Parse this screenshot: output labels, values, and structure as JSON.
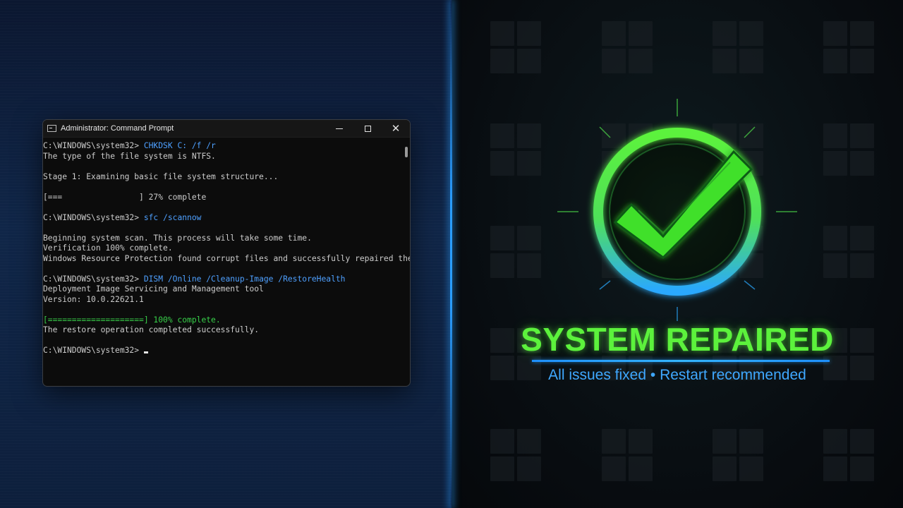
{
  "window": {
    "title": "Administrator: Command Prompt",
    "controls": {
      "minimize_icon": "minimize-icon",
      "maximize_icon": "maximize-icon",
      "close_icon": "close-icon"
    }
  },
  "terminal": {
    "lines": [
      {
        "prompt": "C:\\WINDOWS\\system32>",
        "command": " CHKDSK C: /f /r",
        "text": "",
        "style": "cmd"
      },
      {
        "prompt": "",
        "command": "",
        "text": "The type of the file system is NTFS.",
        "style": "normal"
      },
      {
        "prompt": "",
        "command": "",
        "text": "",
        "style": "normal"
      },
      {
        "prompt": "",
        "command": "",
        "text": "Stage 1: Examining basic file system structure...",
        "style": "normal"
      },
      {
        "prompt": "",
        "command": "",
        "text": "",
        "style": "normal"
      },
      {
        "prompt": "",
        "command": "",
        "text": "[===                ] 27% complete",
        "style": "normal"
      },
      {
        "prompt": "",
        "command": "",
        "text": "",
        "style": "normal"
      },
      {
        "prompt": "C:\\WINDOWS\\system32>",
        "command": " sfc /scannow",
        "text": "",
        "style": "cmd"
      },
      {
        "prompt": "",
        "command": "",
        "text": "",
        "style": "normal"
      },
      {
        "prompt": "",
        "command": "",
        "text": "Beginning system scan. This process will take some time.",
        "style": "normal"
      },
      {
        "prompt": "",
        "command": "",
        "text": "Verification 100% complete.",
        "style": "normal"
      },
      {
        "prompt": "",
        "command": "",
        "text": "Windows Resource Protection found corrupt files and successfully repaired them.",
        "style": "normal"
      },
      {
        "prompt": "",
        "command": "",
        "text": "",
        "style": "normal"
      },
      {
        "prompt": "C:\\WINDOWS\\system32>",
        "command": " DISM /Online /Cleanup-Image /RestoreHealth",
        "text": "",
        "style": "cmd"
      },
      {
        "prompt": "",
        "command": "",
        "text": "Deployment Image Servicing and Management tool",
        "style": "normal"
      },
      {
        "prompt": "",
        "command": "",
        "text": "Version: 10.0.22621.1",
        "style": "normal"
      },
      {
        "prompt": "",
        "command": "",
        "text": "",
        "style": "normal"
      },
      {
        "prompt": "",
        "command": "",
        "text": "[====================] 100% complete.",
        "style": "green"
      },
      {
        "prompt": "",
        "command": "",
        "text": "The restore operation completed successfully.",
        "style": "normal"
      },
      {
        "prompt": "",
        "command": "",
        "text": "",
        "style": "normal"
      },
      {
        "prompt": "C:\\WINDOWS\\system32>",
        "command": " ",
        "text": "",
        "style": "cursor"
      }
    ],
    "chkdsk_progress": 0.27,
    "dism_progress": 1.0
  },
  "status": {
    "heading": "SYSTEM REPAIRED",
    "subtitle": "All issues fixed • Restart recommended",
    "icon": "checkmark-circle-icon",
    "colors": {
      "success": "#5cf23c",
      "accent": "#2a9dff"
    }
  }
}
